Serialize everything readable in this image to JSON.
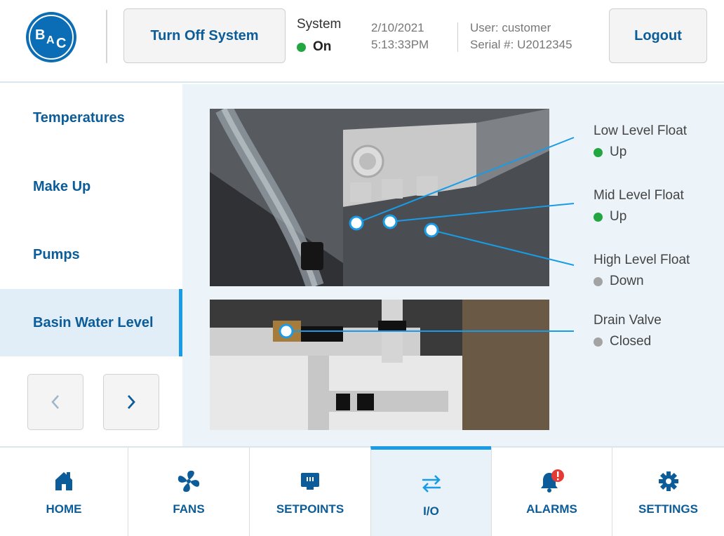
{
  "header": {
    "logo_text": "BAC",
    "turn_off_label": "Turn Off System",
    "system_label": "System",
    "system_status": "On",
    "date": "2/10/2021",
    "time": "5:13:33PM",
    "user": "User: customer",
    "serial": "Serial #: U2012345",
    "logout_label": "Logout"
  },
  "sidebar": {
    "items": [
      {
        "label": "Temperatures"
      },
      {
        "label": "Make Up"
      },
      {
        "label": "Pumps"
      },
      {
        "label": "Basin Water Level"
      }
    ],
    "active_index": 3
  },
  "io": {
    "points": [
      {
        "name": "Low Level Float",
        "state": "Up",
        "color": "#22a640"
      },
      {
        "name": "Mid Level Float",
        "state": "Up",
        "color": "#22a640"
      },
      {
        "name": "High Level Float",
        "state": "Down",
        "color": "#a3a3a3"
      },
      {
        "name": "Drain Valve",
        "state": "Closed",
        "color": "#a3a3a3"
      }
    ]
  },
  "bottom_nav": {
    "tabs": [
      {
        "label": "HOME",
        "icon": "home-icon"
      },
      {
        "label": "FANS",
        "icon": "fan-icon"
      },
      {
        "label": "SETPOINTS",
        "icon": "setpoints-icon"
      },
      {
        "label": "I/O",
        "icon": "swap-arrows-icon"
      },
      {
        "label": "ALARMS",
        "icon": "bell-alert-icon"
      },
      {
        "label": "SETTINGS",
        "icon": "gear-icon"
      }
    ],
    "active_index": 3
  },
  "colors": {
    "brand_blue": "#0b5c99",
    "accent_blue": "#1a9be5",
    "status_green": "#22a640",
    "status_gray": "#a3a3a3",
    "alarm_red": "#e53935"
  }
}
